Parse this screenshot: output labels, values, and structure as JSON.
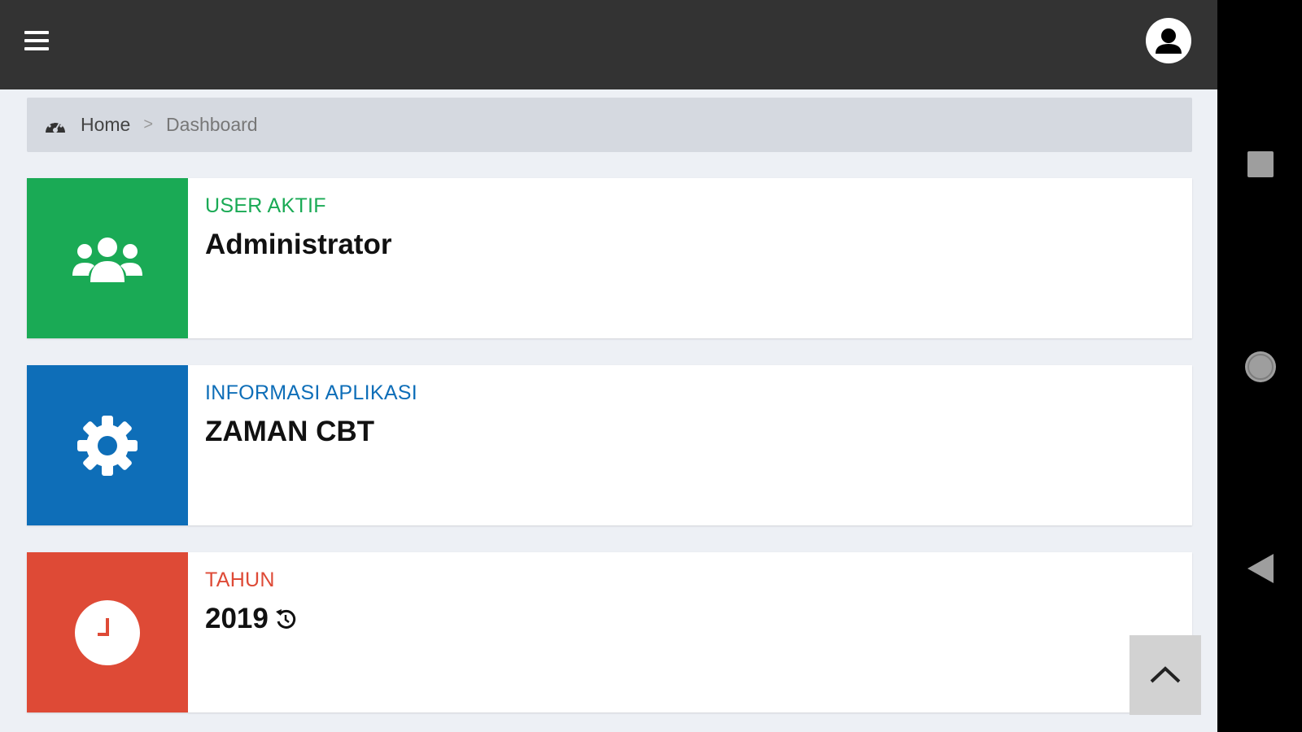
{
  "breadcrumb": {
    "home": "Home",
    "separator": ">",
    "current": "Dashboard"
  },
  "cards": [
    {
      "label": "USER AKTIF",
      "value": "Administrator",
      "color": "#1aaa55",
      "icon": "users-icon"
    },
    {
      "label": "INFORMASI APLIKASI",
      "value": "ZAMAN CBT",
      "color": "#0e6eb8",
      "icon": "gear-icon"
    },
    {
      "label": "TAHUN",
      "value": "2019",
      "color": "#de4a36",
      "icon": "clock-icon"
    }
  ],
  "colors": {
    "topbar": "#333333",
    "page_bg": "#edf0f5",
    "breadcrumb_bg": "#d5d9e0"
  }
}
